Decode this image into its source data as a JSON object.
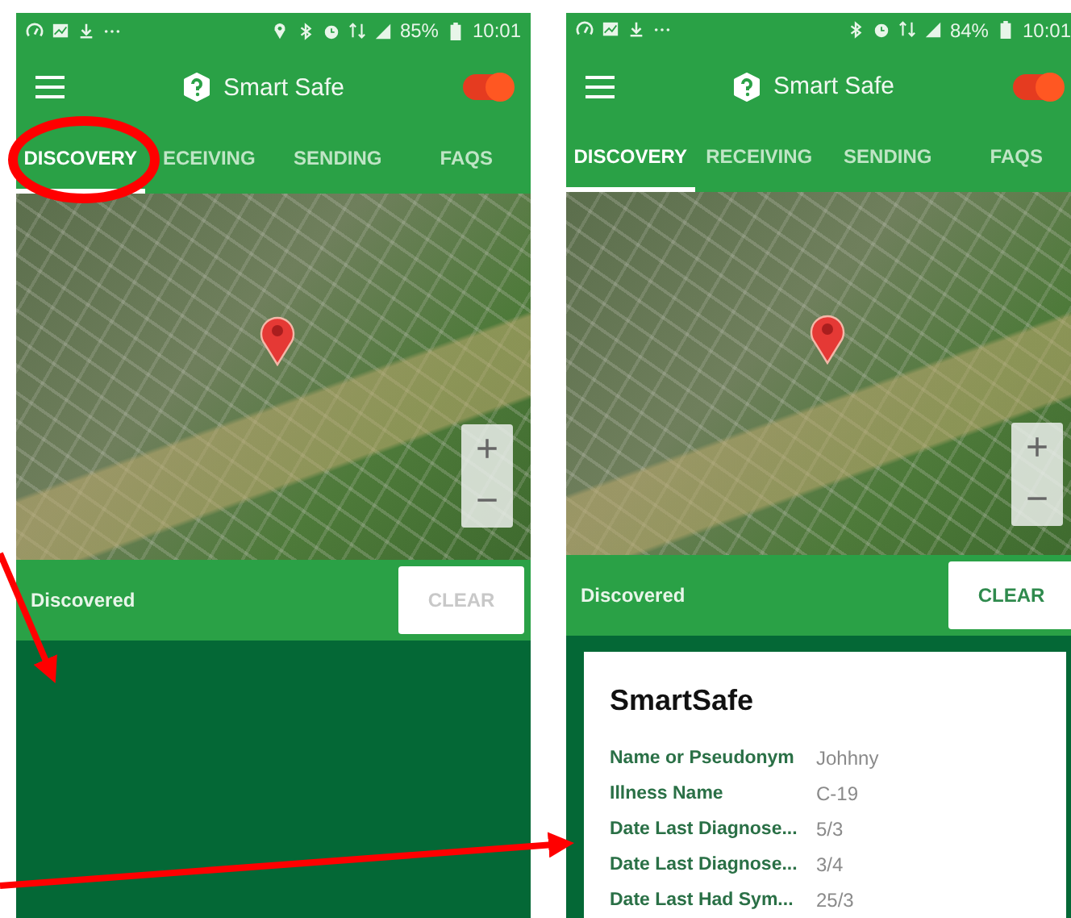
{
  "screens": [
    {
      "status_bar": {
        "location_icon": true,
        "battery": "85%",
        "time": "10:01"
      },
      "app_bar": {
        "title": "Smart Safe",
        "toggle": {
          "on": true
        }
      },
      "tabs": [
        {
          "label": "DISCOVERY",
          "selected": true
        },
        {
          "label": "ECEIVING",
          "selected": false
        },
        {
          "label": "SENDING",
          "selected": false
        },
        {
          "label": "FAQS",
          "selected": false
        }
      ],
      "map": {
        "zoom_in": "+",
        "zoom_out": "−"
      },
      "discovered_bar": {
        "label": "Discovered",
        "clear_button": {
          "label": "CLEAR",
          "disabled": true
        }
      }
    },
    {
      "status_bar": {
        "location_icon": false,
        "battery": "84%",
        "time": "10:01"
      },
      "app_bar": {
        "title": "Smart Safe",
        "toggle": {
          "on": true
        }
      },
      "tabs": [
        {
          "label": "DISCOVERY",
          "selected": true
        },
        {
          "label": "RECEIVING",
          "selected": false
        },
        {
          "label": "SENDING",
          "selected": false
        },
        {
          "label": "FAQS",
          "selected": false
        }
      ],
      "map": {
        "zoom_in": "+",
        "zoom_out": "−"
      },
      "discovered_bar": {
        "label": "Discovered",
        "clear_button": {
          "label": "CLEAR",
          "disabled": false
        }
      },
      "card": {
        "title": "SmartSafe",
        "fields": [
          {
            "label": "Name or Pseudonym",
            "value": "Johhny"
          },
          {
            "label": "Illness Name",
            "value": "C-19"
          },
          {
            "label": "Date Last Diagnose...",
            "value": "5/3"
          },
          {
            "label": "Date Last Diagnose...",
            "value": "3/4"
          },
          {
            "label": "Date Last Had Sym...",
            "value": "25/3"
          }
        ]
      }
    }
  ]
}
